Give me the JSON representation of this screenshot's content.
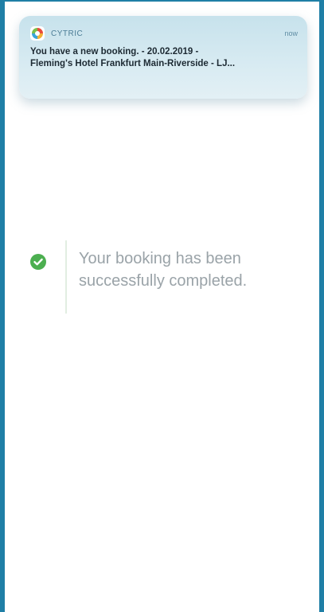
{
  "notification": {
    "app_name": "CYTRIC",
    "time": "now",
    "line1": "You have a new booking. -  20.02.2019 -",
    "line2": "Fleming's Hotel Frankfurt Main-Riverside - LJ..."
  },
  "status": {
    "message_line1": "Your booking has been",
    "message_line2": "successfully completed.",
    "icon": "check-circle-icon"
  },
  "colors": {
    "frame": "#1f7fa6",
    "success": "#4caf50",
    "text_muted": "#9aa3a8"
  }
}
